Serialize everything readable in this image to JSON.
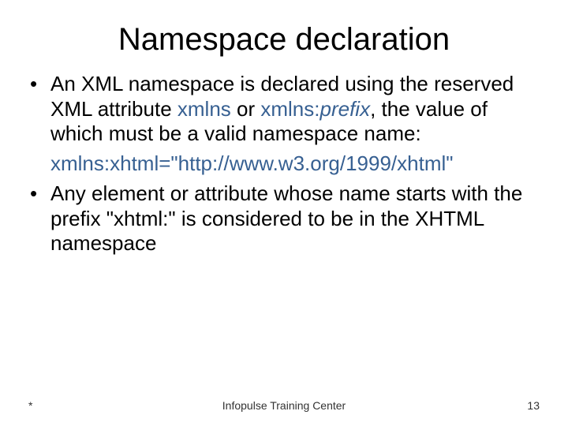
{
  "title": "Namespace declaration",
  "bullets": [
    {
      "pre": "An XML namespace is declared using the reserved XML attribute ",
      "kw1": "xmlns",
      "mid": " or ",
      "kw2_prefix": "xmlns:",
      "kw2_italic": "prefix",
      "post": ", the value of which must be a valid namespace name:"
    },
    {
      "example": "xmlns:xhtml=\"http://www.w3.org/1999/xhtml\""
    },
    {
      "text": "Any element or attribute whose name starts with the prefix \"xhtml:\" is considered to be in the XHTML namespace"
    }
  ],
  "footer": {
    "left": "*",
    "center": "Infopulse Training Center",
    "right": "13"
  }
}
